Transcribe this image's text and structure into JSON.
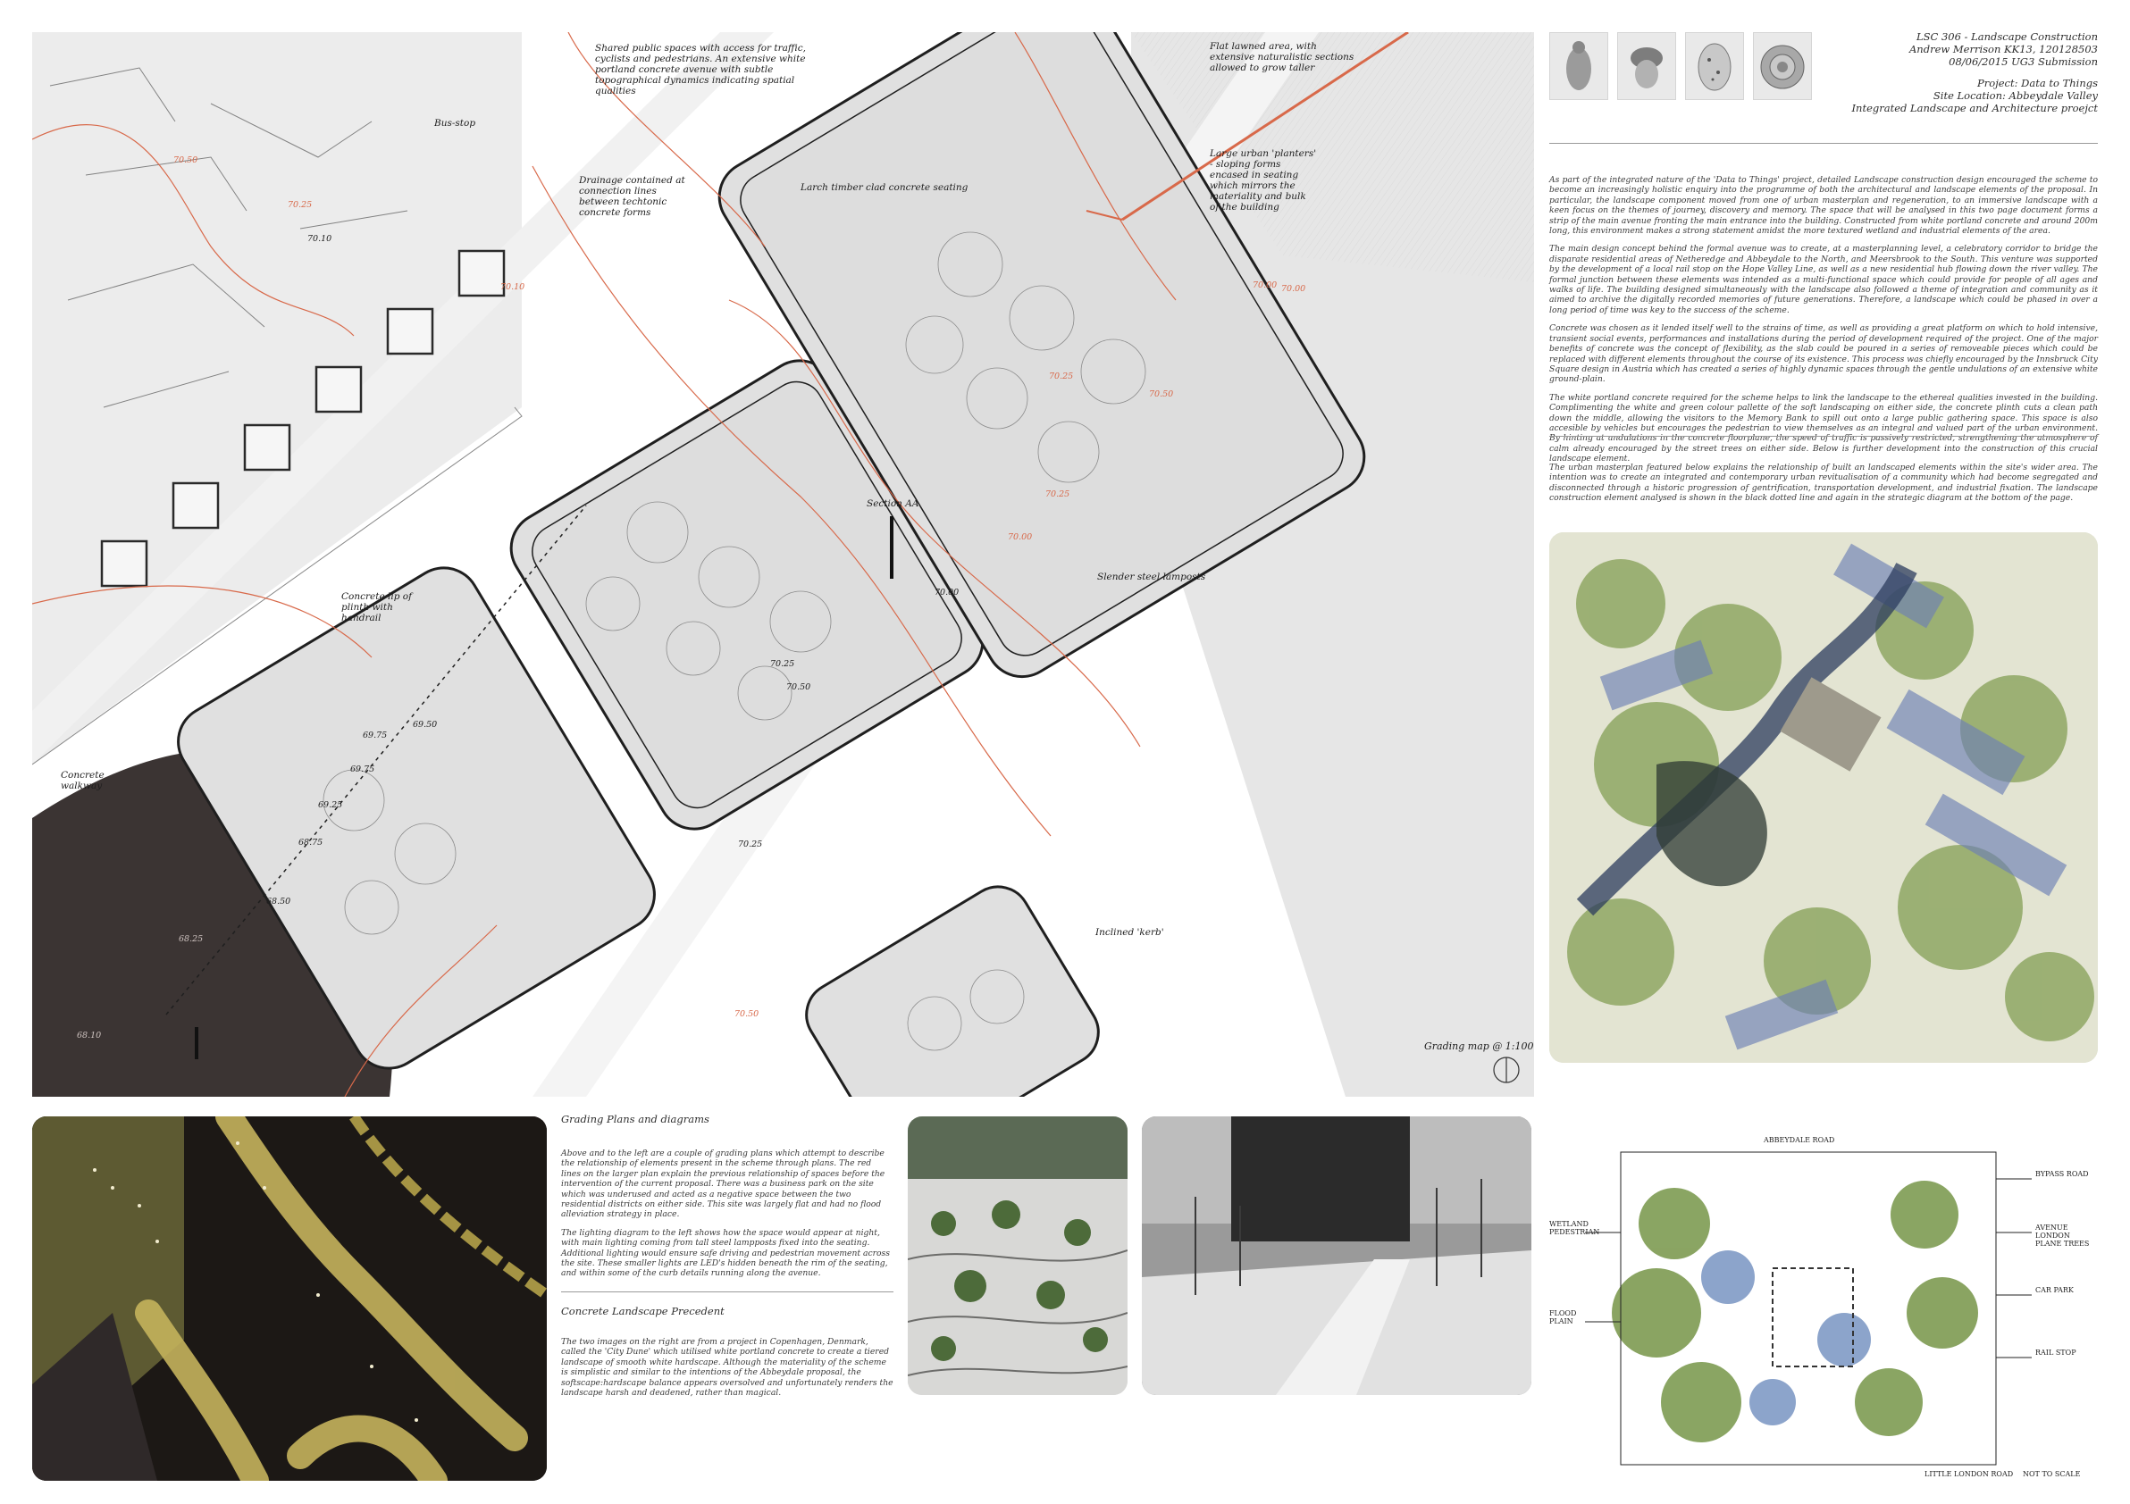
{
  "header": {
    "line1": "LSC 306 - Landscape Construction",
    "line2": "Andrew Merrison KK13, 120128503",
    "line3": "08/06/2015 UG3 Submission",
    "project": "Project: Data to Things",
    "site": "Site Location: Abbeydale Valley",
    "subtitle": "Integrated Landscape and Architecture proejct"
  },
  "thumbnails": [
    "seated-figure-sketch",
    "acorn-sketch",
    "speckled-egg-sketch",
    "shell-sketch"
  ],
  "intro_paragraphs": [
    "As part of the integrated nature of the 'Data to Things' project, detailed Landscape construction design encouraged the scheme to become an increasingly holistic enquiry into the programme of both the architectural and landscape elements of the proposal. In particular, the landscape component moved from one of urban masterplan and regeneration, to an immersive landscape with a keen focus on the themes of journey, discovery and memory. The space that will be analysed in this two page document forms a strip of the main avenue fronting the main entrance into the building. Constructed from white portland concrete and around 200m long, this environment makes a strong statement amidst the more textured wetland and industrial elements of the area.",
    "The main design concept behind the formal avenue was to create, at a masterplanning level, a celebratory corridor to bridge the disparate residential areas of Netheredge and Abbeydale to the North, and Meersbrook to the South. This venture was supported by the development of a local rail stop on the Hope Valley Line, as well as a new residential hub flowing down the river valley. The formal junction between these elements was intended as a multi-functional space which could provide for people of all ages and walks of life. The building designed simultaneously with the landscape also followed a theme of integration and community as it aimed to archive the digitally recorded memories of future generations. Therefore, a landscape which could be phased in over a long period of time was key to the success of the scheme.",
    "Concrete was chosen as it lended itself well to the strains of time, as well as providing a great platform on which to hold intensive, transient social events, performances and installations during the period of development required of the project. One of the major benefits of concrete was the concept of flexibility, as the slab could be poured in a series of removeable pieces which could be replaced with different elements throughout the course of its existence. This process was chiefly encouraged by the Innsbruck City Square design in Austria which has created a series of highly dynamic spaces through the gentle undulations of an extensive white ground-plain.",
    "The white portland concrete required for the scheme helps to link the landscape to the ethereal qualities invested in the building. Complimenting the white and green colour pallette of the soft landscaping on either side, the concrete plinth cuts a clean path down the middle, allowing the visitors to the Memory Bank to spill out onto a large public gathering space. This space is also accesible by vehicles but encourages the pedestrian to view themselves as an integral and valued part of the urban environment. By hinting at undulations in the concrete floorplane, the speed of traffic is passively restricted, strengthening the atmosphere of calm already encouraged by the street trees on either side. Below is further development into the construction of this crucial landscape element."
  ],
  "masterplan_text": "The urban masterplan featured below explains the relationship of built an landscaped elements within the site's wider area. The intention was to create an integrated and contemporary urban revitualisation of a community which had become segregated and disconnected through a historic progression of gentrification, transportation development, and industrial fixation. The landscape construction element analysed is shown in the black dotted line and again in the strategic diagram at the bottom of the page.",
  "plan_annotations": {
    "shared_space": "Shared public spaces with access for traffic, cyclists and pedestrians. An extensive white portland concrete avenue with subtle topographical dynamics indicating spatial qualities",
    "flat_lawn": "Flat lawned area, with extensive naturalistic sections allowed to grow taller",
    "bus_stop": "Bus-stop",
    "drainage": "Drainage contained at connection lines between techtonic concrete forms",
    "larch": "Larch timber clad concrete seating",
    "planters": "Large urban 'planters' - sloping forms encased in seating which mirrors the materiality and bulk of the building",
    "section": "Section AA",
    "plinth": "Concrete lip of plinth with handrail",
    "lampposts": "Slender steel lamposts",
    "walkway": "Concrete walkway",
    "kerb": "Inclined 'kerb'",
    "scale": "Grading map @ 1:100"
  },
  "levels": [
    {
      "t": "70.50",
      "red": true
    },
    {
      "t": "70.25",
      "red": true
    },
    {
      "t": "70.10",
      "red": false
    },
    {
      "t": "70.10",
      "red": true
    },
    {
      "t": "70.00",
      "red": true
    },
    {
      "t": "70.25",
      "red": true
    },
    {
      "t": "70.00",
      "red": false
    },
    {
      "t": "70.25",
      "red": false
    },
    {
      "t": "70.50",
      "red": false
    },
    {
      "t": "70.25",
      "red": false
    },
    {
      "t": "69.50",
      "red": false
    },
    {
      "t": "69.75",
      "red": false
    },
    {
      "t": "69.75",
      "red": false
    },
    {
      "t": "69.25",
      "red": false
    },
    {
      "t": "68.75",
      "red": false
    },
    {
      "t": "68.50",
      "red": false
    },
    {
      "t": "68.25",
      "red": false
    },
    {
      "t": "68.10",
      "red": false
    },
    {
      "t": "70.25",
      "red": true
    },
    {
      "t": "70.50",
      "red": true
    },
    {
      "t": "70.00",
      "red": true
    },
    {
      "t": "70.50",
      "red": true
    },
    {
      "t": "70.00",
      "red": true
    }
  ],
  "grading": {
    "heading": "Grading Plans and diagrams",
    "p1": "Above and to the left are a couple of grading plans which attempt to describe the relationship of elements present in the scheme through plans. The red lines on the larger plan explain the previous relationship of spaces before the intervention of the current proposal. There was a business park on the site which was underused and acted as a negative space between the two residential districts on either side. This site was largely flat and had no flood alleviation strategy in place.",
    "p2": "The lighting diagram to the left shows how the space would appear at night, with main lighting coming from tall steel lampposts fixed into the seating. Additional lighting would ensure safe driving and pedestrian movement across the site. These smaller lights are LED's hidden beneath the rim of the seating, and within some of the curb details running along the avenue."
  },
  "precedent": {
    "heading": "Concrete Landscape Precedent",
    "p1": "The two images on the right are from a project in Copenhagen, Denmark, called the 'City Dune' which utilised white portland concrete to create a tiered landscape of smooth white hardscape. Although the materiality of the scheme is simplistic and similar to the intentions of the Abbeydale proposal, the softscape:hardscape balance appears oversolved and unfortunately renders the landscape harsh and deadened, rather than magical."
  },
  "sketch_labels": {
    "wetland": "WETLAND PEDESTRIAN",
    "flood": "FLOOD PLAIN",
    "bypass": "BYPASS ROAD",
    "avenue": "AVENUE LONDON PLANE TREES",
    "stop": "NOT TO SCALE",
    "littlelondon": "LITTLE LONDON ROAD",
    "carpark": "CAR PARK",
    "abbeydale": "ABBEYDALE ROAD",
    "rail": "RAIL STOP"
  },
  "colors": {
    "plan_grey": "#ececec",
    "dark_fill": "#3b3433",
    "red_line": "#d8694a",
    "gold": "#c5b35c",
    "night_bg": "#1c1815"
  }
}
